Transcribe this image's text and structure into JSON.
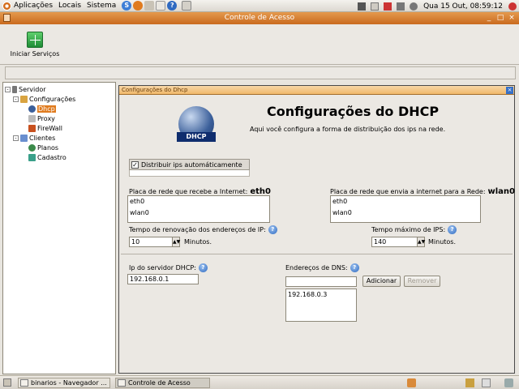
{
  "top_panel": {
    "menus": [
      "Aplicações",
      "Locais",
      "Sistema"
    ],
    "clock": "Qua 15 Out, 08:59:12"
  },
  "window": {
    "title": "Controle de Acesso"
  },
  "toolbar": {
    "start_services_label": "Iniciar Serviços"
  },
  "tree": {
    "root": "Servidor",
    "items": [
      {
        "label": "Configurações",
        "level": 1
      },
      {
        "label": "Dhcp",
        "level": 2,
        "selected": true
      },
      {
        "label": "Proxy",
        "level": 2
      },
      {
        "label": "FireWall",
        "level": 2
      },
      {
        "label": "Clientes",
        "level": 1
      },
      {
        "label": "Planos",
        "level": 2
      },
      {
        "label": "Cadastro",
        "level": 2
      }
    ]
  },
  "dhcp_frame": {
    "frame_title": "Configurações do Dhcp",
    "heading": "Configurações do DHCP",
    "subtitle": "Aqui você configura a forma de distribuição dos ips na rede.",
    "logo_text": "DHCP",
    "distribute_checkbox": {
      "label": "Distribuir ips automáticamente",
      "checked": true
    },
    "receive_nic": {
      "label": "Placa de rede que recebe a Internet:",
      "value": "eth0",
      "options": [
        "eth0",
        "wlan0"
      ]
    },
    "send_nic": {
      "label": "Placa de rede que envia a internet para a Rede:",
      "value": "wlan0",
      "options": [
        "eth0",
        "wlan0"
      ]
    },
    "renewal": {
      "label": "Tempo de renovação dos endereços de IP:",
      "value": "10",
      "unit": "Minutos."
    },
    "max_time": {
      "label": "Tempo máximo de IPS:",
      "value": "140",
      "unit": "Minutos."
    },
    "server_ip": {
      "label": "Ip do servidor DHCP:",
      "value": "192.168.0.1"
    },
    "dns": {
      "label": "Endereços de DNS:",
      "input_value": "",
      "add_label": "Adicionar",
      "remove_label": "Remover",
      "entries": [
        "192.168.0.3"
      ]
    }
  },
  "taskbar": {
    "tasks": [
      "binarios - Navegador ...",
      "Controle de Acesso"
    ]
  },
  "colors": {
    "accent": "#e07b1e",
    "title_bar": "#d9823a",
    "frame_title_bar": "#f0b86b"
  }
}
